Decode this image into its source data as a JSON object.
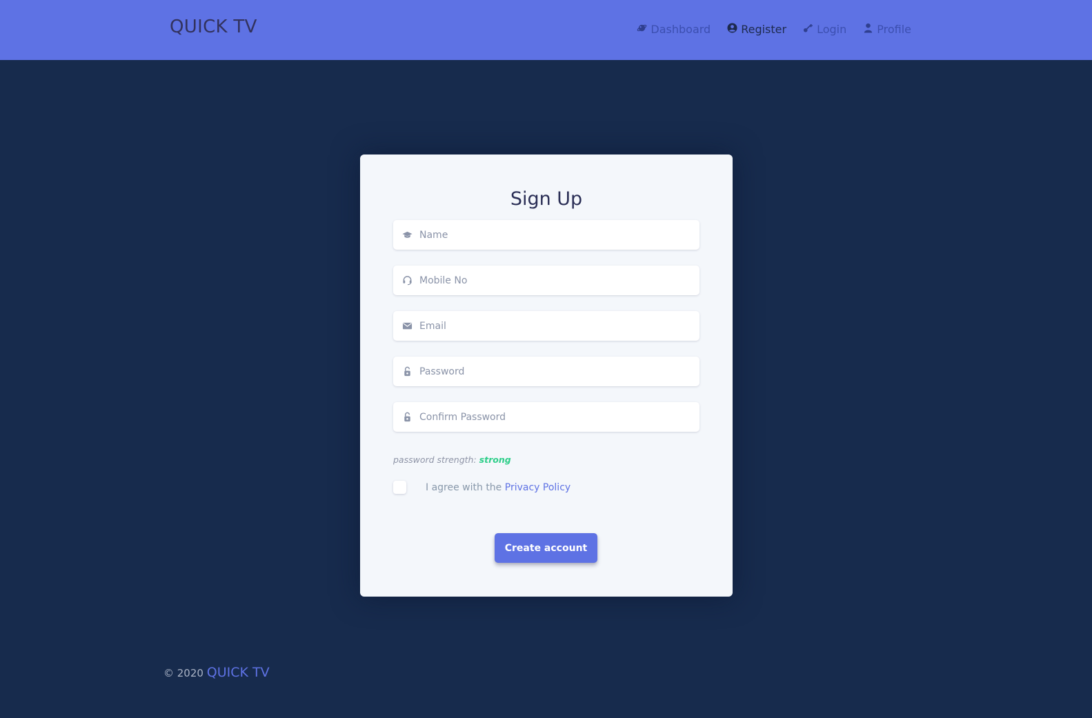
{
  "header": {
    "brand": "QUICK TV",
    "nav": [
      {
        "label": "Dashboard",
        "icon": "planet-icon"
      },
      {
        "label": "Register",
        "icon": "user-circle-icon",
        "active": true
      },
      {
        "label": "Login",
        "icon": "key-icon"
      },
      {
        "label": "Profile",
        "icon": "user-icon"
      }
    ]
  },
  "form": {
    "title": "Sign Up",
    "fields": {
      "name": {
        "placeholder": "Name",
        "icon": "graduation-cap-icon"
      },
      "mobile": {
        "placeholder": "Mobile No",
        "icon": "headset-icon"
      },
      "email": {
        "placeholder": "Email",
        "icon": "envelope-icon"
      },
      "password": {
        "placeholder": "Password",
        "icon": "lock-icon"
      },
      "confirm_password": {
        "placeholder": "Confirm Password",
        "icon": "lock-icon"
      }
    },
    "strength_label": "password strength:",
    "strength_value": "strong",
    "agree_text": "I agree with the",
    "privacy_link": "Privacy Policy",
    "submit_label": "Create account"
  },
  "footer": {
    "copyright": "© 2020",
    "brand_link": "QUICK TV"
  },
  "colors": {
    "primary": "#5e72e4",
    "background": "#172b4d",
    "success": "#2dce89"
  }
}
